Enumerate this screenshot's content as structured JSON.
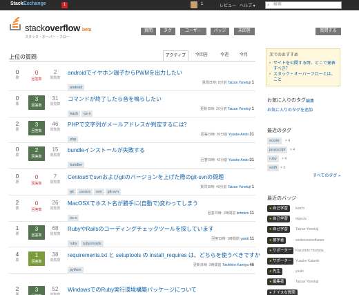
{
  "topbar": {
    "brand_a": "Stack",
    "brand_b": "Exchange",
    "inbox_count": "1",
    "rep": "1",
    "links": [
      "レビュー",
      "ヘルプ ▾"
    ],
    "search_placeholder": "検索"
  },
  "header": {
    "logo_a": "stack",
    "logo_b": "overflow",
    "logo_beta": "beta",
    "logo_sub": "スタック・オーバー・フロー",
    "nav": [
      "質問",
      "タグ",
      "ユーザー",
      "バッジ",
      "未回答"
    ],
    "ask": "質問する"
  },
  "main": {
    "title": "上位の質問",
    "tabs": [
      "アクティブ",
      "今回答",
      "今週",
      "今月"
    ],
    "labels": {
      "votes": "票",
      "answers": "回答数",
      "views": "閲覧数"
    },
    "questions": [
      {
        "votes": "0",
        "answers": "0",
        "views": "2",
        "state": "zero",
        "title": "androidでイヤホン端子からPWMを出力したい",
        "tags": [
          "android"
        ],
        "meta_action": "質問日時",
        "meta_time": "8分前",
        "meta_user": "Taizan Yonetuji",
        "meta_rep": "1"
      },
      {
        "votes": "0",
        "answers": "3",
        "views": "31",
        "state": "answered",
        "title": "コマンドが終了したら音を鳴らしたい",
        "tags": [
          "bash",
          "os-x"
        ],
        "meta_action": "更新日時",
        "meta_time": "20分前",
        "meta_user": "Taizan Yonetuji",
        "meta_rep": "1"
      },
      {
        "votes": "2",
        "answers": "3",
        "views": "46",
        "state": "answered",
        "title": "PHPで文字列がメールアドレスか判定するには？",
        "tags": [
          "php"
        ],
        "meta_action": "回答日時",
        "meta_time": "36分前",
        "meta_user": "Yusuke Ando",
        "meta_rep": "31"
      },
      {
        "votes": "0",
        "answers": "2",
        "views": "15",
        "state": "answered",
        "title": "bundleインストールが失敗する",
        "tags": [
          "bundler"
        ],
        "meta_action": "回答日時",
        "meta_time": "42分前",
        "meta_user": "Yusuke Ando",
        "meta_rep": "31"
      },
      {
        "votes": "0",
        "answers": "0",
        "views": "7",
        "state": "zero",
        "title": "Centos6でsvnおよびgitのバージョンを上げた際のgit-svnの問題",
        "tags": [
          "git",
          "centos",
          "svn",
          "git-svn"
        ],
        "meta_action": "質問日時",
        "meta_time": "49分前",
        "meta_user": "Taizan Yonetuji",
        "meta_rep": "1"
      },
      {
        "votes": "2",
        "answers": "0",
        "views": "26",
        "state": "zero",
        "title": "MacOSXでホスト名が勝手に(自動で)変わってしまう",
        "tags": [
          "os-x"
        ],
        "meta_action": "回答日時",
        "meta_time": "1時間前",
        "meta_user": "kntmkm",
        "meta_rep": "11"
      },
      {
        "votes": "1",
        "answers": "3",
        "views": "68",
        "state": "answered",
        "title": "RubyやRailsのコーディングチェックツールを探しています",
        "tags": [
          "ruby",
          "rubyonrails"
        ],
        "meta_action": "回答日時",
        "meta_time": "1時間前",
        "meta_user": "yandi",
        "meta_rep": "11"
      },
      {
        "votes": "4",
        "answers": "1",
        "views": "38",
        "state": "accepted",
        "title": "requirements.txt と setuptools の install_requires は、どちらを使うべきですか",
        "tags": [
          "python"
        ],
        "meta_action": "更新日時",
        "meta_time": "2時間前",
        "meta_user": "Toshihiro Kamiya",
        "meta_rep": "46"
      },
      {
        "votes": "2",
        "answers": "3",
        "views": "52",
        "state": "answered",
        "title": "WindowsでのRuby実行環境構築パッケージについて",
        "tags": [],
        "meta_action": "",
        "meta_time": "",
        "meta_user": "",
        "meta_rep": ""
      }
    ]
  },
  "sidebar": {
    "welcome_title": "次でのおすすめ",
    "welcome_items": [
      "サイトを公開する時、どこで発表すべき？",
      "スタック・オーバーフローとは、こと"
    ],
    "fav_title": "お気に入りのタグ",
    "fav_edit": "編集",
    "fav_add": "お気に入りのタグを追加",
    "recent_tags_title": "最近のタグ",
    "recent_tags": [
      {
        "name": "xcode",
        "count": "× 4"
      },
      {
        "name": "javascript",
        "count": "× 4"
      },
      {
        "name": "ruby",
        "count": "× 4"
      },
      {
        "name": "swift",
        "count": "× 3"
      }
    ],
    "all_tags": "すべてのタグ »",
    "recent_badges_title": "最近のバッジ",
    "recent_badges": [
      {
        "name": "自己学習",
        "user": "koizhi",
        "kind": "bronze"
      },
      {
        "name": "自己学習",
        "user": "objects",
        "kind": "bronze"
      },
      {
        "name": "自己学習",
        "user": "Taizan Yonetuji",
        "kind": "bronze"
      },
      {
        "name": "被学者",
        "user": "sooleisnotsoftware",
        "kind": "bronze"
      },
      {
        "name": "サポーター",
        "user": "Kazuhide Hoshida",
        "kind": "bronze"
      },
      {
        "name": "サポーター",
        "user": "Yusuke Kataoki",
        "kind": "bronze"
      },
      {
        "name": "先生",
        "user": "yuuki",
        "kind": "bronze"
      },
      {
        "name": "編集者",
        "user": "Taizan Yonetuji",
        "kind": "bronze"
      },
      {
        "name": "ナイスな質問",
        "user": "",
        "kind": "silver"
      }
    ]
  }
}
